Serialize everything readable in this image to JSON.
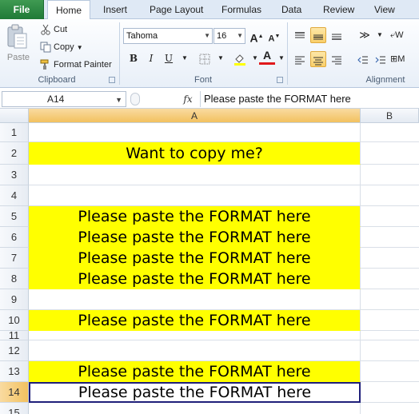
{
  "tabs": [
    "File",
    "Home",
    "Insert",
    "Page Layout",
    "Formulas",
    "Data",
    "Review",
    "View"
  ],
  "clipboard": {
    "paste": "Paste",
    "cut": "Cut",
    "copy": "Copy",
    "format_painter": "Format Painter",
    "group_label": "Clipboard"
  },
  "font": {
    "name": "Tahoma",
    "size": "16",
    "group_label": "Font",
    "bold": "B",
    "italic": "I",
    "underline": "U"
  },
  "alignment": {
    "group_label": "Alignment",
    "wrap_partial": "W",
    "merge_partial": "M"
  },
  "formula_bar": {
    "name_box": "A14",
    "fx": "fx",
    "content": "Please paste the FORMAT here"
  },
  "columns": [
    "A",
    "B"
  ],
  "rows": [
    {
      "num": "1",
      "text": "",
      "yellow": false
    },
    {
      "num": "2",
      "text": "Want to copy me?",
      "yellow": true
    },
    {
      "num": "3",
      "text": "",
      "yellow": false
    },
    {
      "num": "4",
      "text": "",
      "yellow": false
    },
    {
      "num": "5",
      "text": "Please paste the FORMAT here",
      "yellow": true
    },
    {
      "num": "6",
      "text": "Please paste the FORMAT here",
      "yellow": true
    },
    {
      "num": "7",
      "text": "Please paste the FORMAT here",
      "yellow": true
    },
    {
      "num": "8",
      "text": "Please paste the FORMAT here",
      "yellow": true
    },
    {
      "num": "9",
      "text": "",
      "yellow": false
    },
    {
      "num": "10",
      "text": "Please paste the FORMAT here",
      "yellow": true
    },
    {
      "num": "11",
      "text": "",
      "yellow": false
    },
    {
      "num": "12",
      "text": "",
      "yellow": false
    },
    {
      "num": "13",
      "text": "Please paste the FORMAT here",
      "yellow": true
    },
    {
      "num": "14",
      "text": "Please paste the FORMAT here",
      "yellow": false,
      "active": true
    },
    {
      "num": "15",
      "text": "",
      "yellow": false
    }
  ],
  "colors": {
    "highlight": "#ffff00",
    "active_border": "#1f1f7a",
    "selected_header": "#f2c15f"
  }
}
